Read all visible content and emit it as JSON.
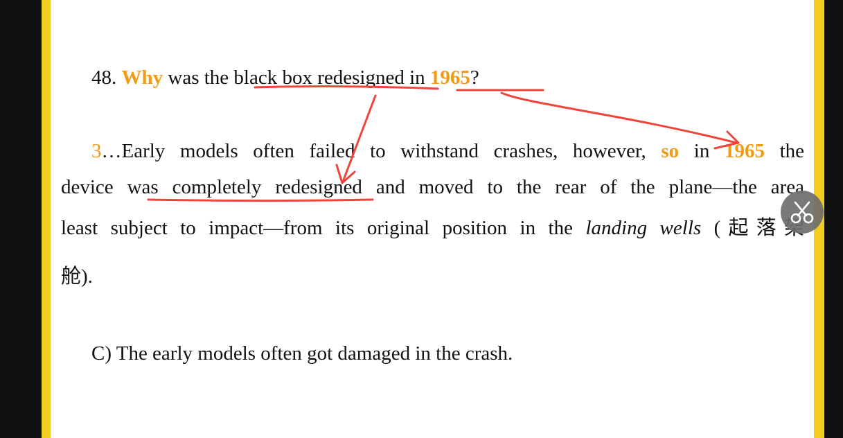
{
  "question": {
    "number": "48.",
    "word_why": "Why",
    "text_mid": "was the black box redesigned in",
    "year": "1965",
    "end": "?"
  },
  "passage": {
    "para_num": "3",
    "line1_a": "…Early models often failed to withstand crashes, however,",
    "line1_so": "so",
    "line1_in": "in",
    "line1_year": "1965",
    "line1_end": "the",
    "line2": "device was completely redesigned and moved to the rear of the plane—the area",
    "line3_a": "least subject to impact—from its original position in the",
    "line3_ital": "landing wells",
    "line3_b": "(起落架",
    "line4": "舱)."
  },
  "answer": {
    "text": "C) The early models often got damaged in the crash."
  },
  "colors": {
    "highlight": "#f39a14",
    "annotation": "#f0443b",
    "frame": "#f2cc1f"
  },
  "toolbar": {
    "cut_icon": "scissors-icon"
  }
}
